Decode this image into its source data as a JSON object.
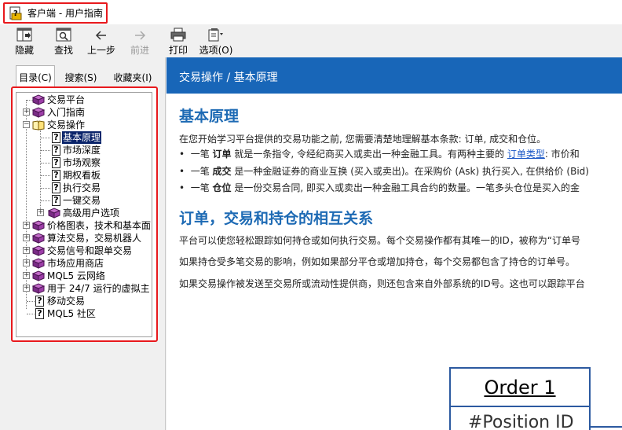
{
  "window": {
    "title": "客户端 - 用户指南"
  },
  "toolbar": {
    "hide": "隐藏",
    "find": "查找",
    "back": "上一步",
    "forward": "前进",
    "print": "打印",
    "options": "选项(O)"
  },
  "tabs": {
    "contents": "目录(C)",
    "search": "搜索(S)",
    "favorites": "收藏夹(I)"
  },
  "tree": {
    "items": [
      "交易平台",
      "入门指南",
      "交易操作",
      "基本原理",
      "市场深度",
      "市场观察",
      "期权看板",
      "执行交易",
      "一键交易",
      "高级用户选项",
      "价格图表，技术和基本面",
      "算法交易，交易机器人",
      "交易信号和跟单交易",
      "市场应用商店",
      "MQL5 云网络",
      "用于 24/7 运行的虚拟主",
      "移动交易",
      "MQL5 社区"
    ]
  },
  "content": {
    "breadcrumb": "交易操作 / 基本原理",
    "heading": "基本原理",
    "intro": "在您开始学习平台提供的交易功能之前, 您需要清楚地理解基本条款: 订单, 成交和仓位。",
    "b1_pre": "一笔 ",
    "b1_bold": "订单",
    "b1_mid": " 就是一条指令, 令经纪商买入或卖出一种金融工具。有两种主要的 ",
    "b1_link": "订单类型",
    "b1_post": ": 市价和",
    "b2_pre": "一笔 ",
    "b2_bold": "成交",
    "b2_post": " 是一种金融证券的商业互换 (买入或卖出)。在采购价 (Ask) 执行买入, 在供给价 (Bid)",
    "b3_pre": "一笔 ",
    "b3_bold": "仓位",
    "b3_post": " 是一份交易合同, 即买入或卖出一种金融工具合约的数量。一笔多头仓位是买入的金",
    "heading2": "订单，交易和持仓的相互关系",
    "p2": "平台可以使您轻松跟踪如何持仓或如何执行交易。每个交易操作都有其唯一的ID，被称为“订单号",
    "p3": "如果持仓受多笔交易的影响，例如如果部分平仓或增加持仓，每个交易都包含了持仓的订单号。",
    "p4": "如果交易操作被发送至交易所或流动性提供商，则还包含来自外部系统的ID号。这也可以跟踪平台",
    "diagram_title": "Order 1",
    "diagram_field": "#Position ID"
  }
}
